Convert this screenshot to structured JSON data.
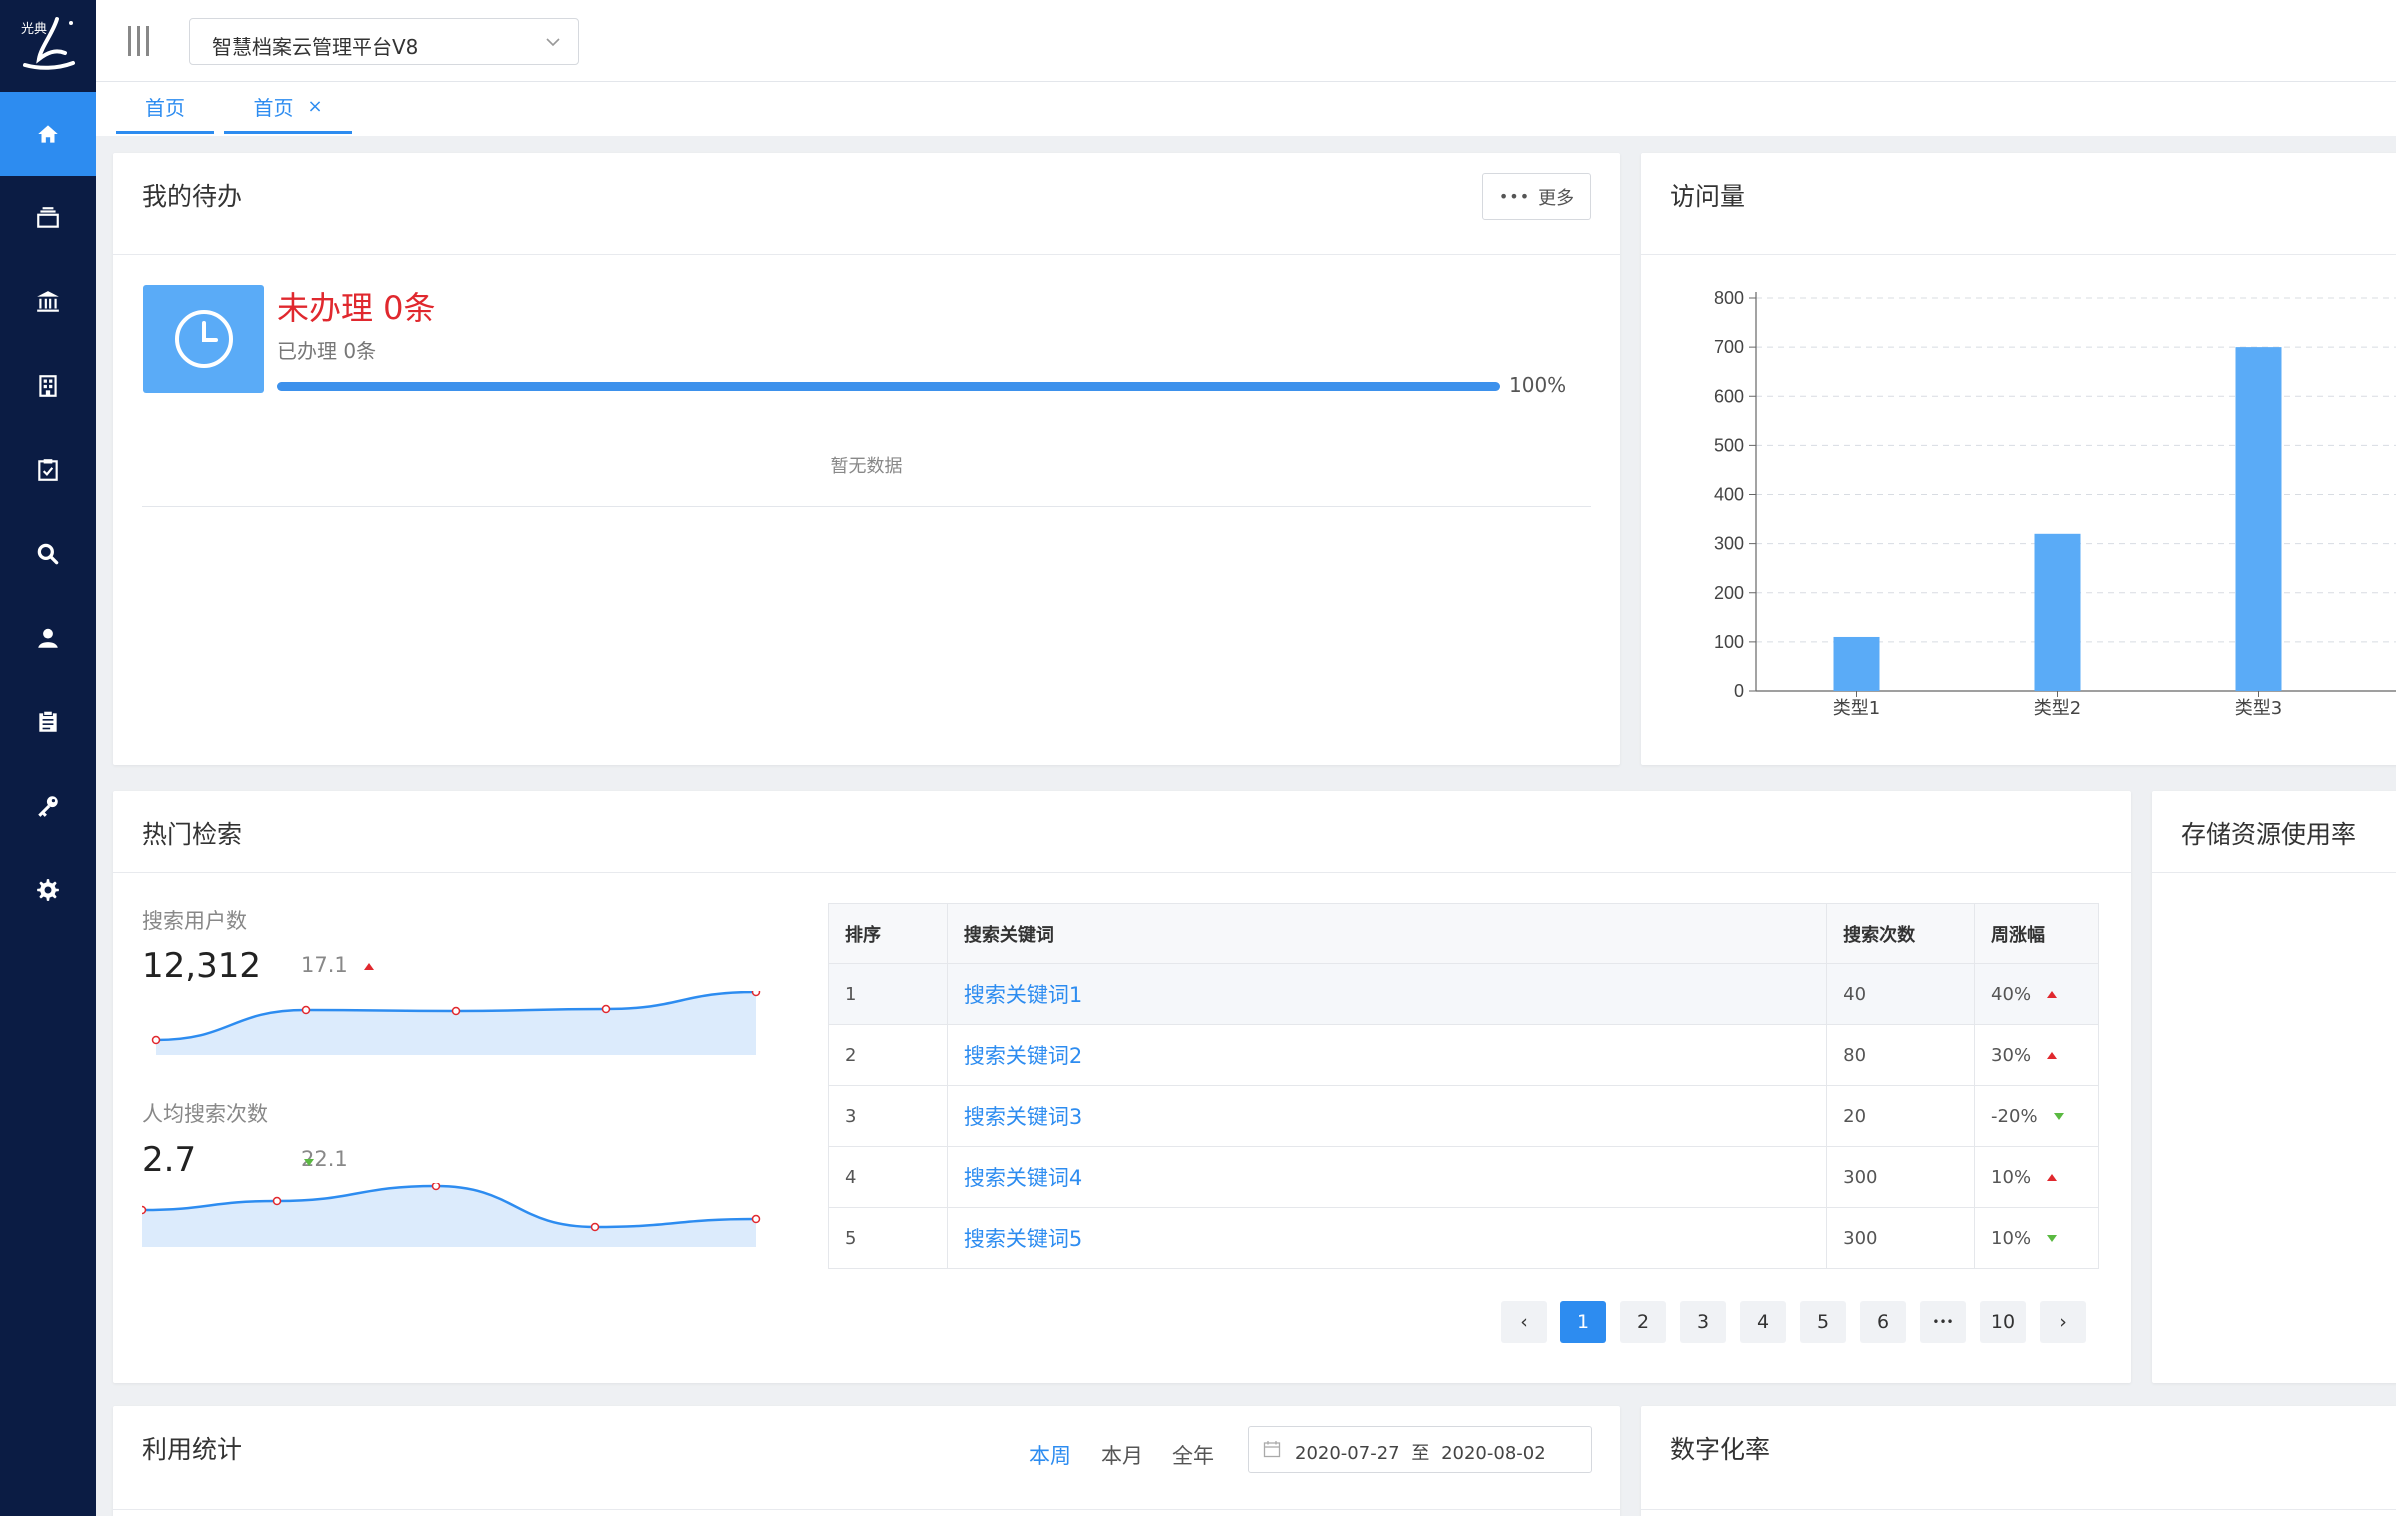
{
  "sidebar": {
    "logo_text": "光典",
    "items": [
      {
        "name": "home",
        "icon": "home-icon",
        "active": true
      },
      {
        "name": "archive",
        "icon": "archive-box-icon"
      },
      {
        "name": "museum",
        "icon": "bank-icon"
      },
      {
        "name": "building",
        "icon": "building-icon"
      },
      {
        "name": "task",
        "icon": "clipboard-check-icon"
      },
      {
        "name": "search",
        "icon": "search-icon"
      },
      {
        "name": "user",
        "icon": "user-icon"
      },
      {
        "name": "document",
        "icon": "clipboard-icon"
      },
      {
        "name": "key",
        "icon": "key-icon"
      },
      {
        "name": "settings",
        "icon": "gear-icon"
      }
    ]
  },
  "header": {
    "platform": "智慧档案云管理平台V8"
  },
  "tabs": [
    {
      "label": "首页"
    },
    {
      "label": "首页",
      "close": "×"
    }
  ],
  "todo": {
    "title": "我的待办",
    "more": "更多",
    "pending": "未办理 0条",
    "done": "已办理 0条",
    "progress": 100,
    "progress_text": "100%",
    "empty": "暂无数据"
  },
  "visits": {
    "title": "访问量",
    "chart_data": {
      "type": "bar",
      "categories": [
        "类型1",
        "类型2",
        "类型3"
      ],
      "values": [
        110,
        320,
        700
      ],
      "ylim": [
        0,
        800
      ],
      "yticks": [
        0,
        100,
        200,
        300,
        400,
        500,
        600,
        700,
        800
      ],
      "grid": true,
      "bar_color": "#5aabf7"
    }
  },
  "hot_search": {
    "title": "热门检索",
    "users_label": "搜索用户数",
    "users_value": "12,312",
    "users_change": "17.1",
    "avg_label": "人均搜索次数",
    "avg_value": "2.7",
    "avg_change": "22.1",
    "table": {
      "headers": [
        "排序",
        "搜索关键词",
        "搜索次数",
        "周涨幅"
      ],
      "rows": [
        {
          "rank": "1",
          "keyword": "搜索关键词1",
          "count": "40",
          "change": "40%",
          "trend": "up"
        },
        {
          "rank": "2",
          "keyword": "搜索关键词2",
          "count": "80",
          "change": "30%",
          "trend": "up"
        },
        {
          "rank": "3",
          "keyword": "搜索关键词3",
          "count": "20",
          "change": "-20%",
          "trend": "down"
        },
        {
          "rank": "4",
          "keyword": "搜索关键词4",
          "count": "300",
          "change": "10%",
          "trend": "up"
        },
        {
          "rank": "5",
          "keyword": "搜索关键词5",
          "count": "300",
          "change": "10%",
          "trend": "down"
        }
      ]
    },
    "pagination": {
      "prev": "‹",
      "pages": [
        "1",
        "2",
        "3",
        "4",
        "5",
        "6",
        "•••",
        "10"
      ],
      "current": "1",
      "next": "›"
    }
  },
  "storage": {
    "title": "存储资源使用率"
  },
  "usage": {
    "title": "利用统计",
    "periods": [
      "本周",
      "本月",
      "全年"
    ],
    "active_period": "本周",
    "date_start": "2020-07-27",
    "date_sep": "至",
    "date_end": "2020-08-02"
  },
  "digitization": {
    "title": "数字化率"
  },
  "colors": {
    "accent": "#2d8cf0",
    "sidebar": "#0b1c44",
    "danger": "#e0282e",
    "success": "#5ab941"
  }
}
